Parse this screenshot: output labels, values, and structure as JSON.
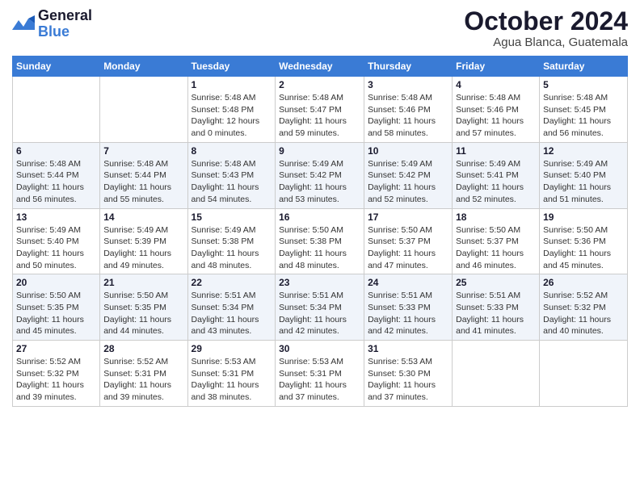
{
  "logo": {
    "text_general": "General",
    "text_blue": "Blue"
  },
  "header": {
    "month": "October 2024",
    "location": "Agua Blanca, Guatemala"
  },
  "weekdays": [
    "Sunday",
    "Monday",
    "Tuesday",
    "Wednesday",
    "Thursday",
    "Friday",
    "Saturday"
  ],
  "weeks": [
    [
      {
        "day": "",
        "info": ""
      },
      {
        "day": "",
        "info": ""
      },
      {
        "day": "1",
        "info": "Sunrise: 5:48 AM\nSunset: 5:48 PM\nDaylight: 12 hours\nand 0 minutes."
      },
      {
        "day": "2",
        "info": "Sunrise: 5:48 AM\nSunset: 5:47 PM\nDaylight: 11 hours\nand 59 minutes."
      },
      {
        "day": "3",
        "info": "Sunrise: 5:48 AM\nSunset: 5:46 PM\nDaylight: 11 hours\nand 58 minutes."
      },
      {
        "day": "4",
        "info": "Sunrise: 5:48 AM\nSunset: 5:46 PM\nDaylight: 11 hours\nand 57 minutes."
      },
      {
        "day": "5",
        "info": "Sunrise: 5:48 AM\nSunset: 5:45 PM\nDaylight: 11 hours\nand 56 minutes."
      }
    ],
    [
      {
        "day": "6",
        "info": "Sunrise: 5:48 AM\nSunset: 5:44 PM\nDaylight: 11 hours\nand 56 minutes."
      },
      {
        "day": "7",
        "info": "Sunrise: 5:48 AM\nSunset: 5:44 PM\nDaylight: 11 hours\nand 55 minutes."
      },
      {
        "day": "8",
        "info": "Sunrise: 5:48 AM\nSunset: 5:43 PM\nDaylight: 11 hours\nand 54 minutes."
      },
      {
        "day": "9",
        "info": "Sunrise: 5:49 AM\nSunset: 5:42 PM\nDaylight: 11 hours\nand 53 minutes."
      },
      {
        "day": "10",
        "info": "Sunrise: 5:49 AM\nSunset: 5:42 PM\nDaylight: 11 hours\nand 52 minutes."
      },
      {
        "day": "11",
        "info": "Sunrise: 5:49 AM\nSunset: 5:41 PM\nDaylight: 11 hours\nand 52 minutes."
      },
      {
        "day": "12",
        "info": "Sunrise: 5:49 AM\nSunset: 5:40 PM\nDaylight: 11 hours\nand 51 minutes."
      }
    ],
    [
      {
        "day": "13",
        "info": "Sunrise: 5:49 AM\nSunset: 5:40 PM\nDaylight: 11 hours\nand 50 minutes."
      },
      {
        "day": "14",
        "info": "Sunrise: 5:49 AM\nSunset: 5:39 PM\nDaylight: 11 hours\nand 49 minutes."
      },
      {
        "day": "15",
        "info": "Sunrise: 5:49 AM\nSunset: 5:38 PM\nDaylight: 11 hours\nand 48 minutes."
      },
      {
        "day": "16",
        "info": "Sunrise: 5:50 AM\nSunset: 5:38 PM\nDaylight: 11 hours\nand 48 minutes."
      },
      {
        "day": "17",
        "info": "Sunrise: 5:50 AM\nSunset: 5:37 PM\nDaylight: 11 hours\nand 47 minutes."
      },
      {
        "day": "18",
        "info": "Sunrise: 5:50 AM\nSunset: 5:37 PM\nDaylight: 11 hours\nand 46 minutes."
      },
      {
        "day": "19",
        "info": "Sunrise: 5:50 AM\nSunset: 5:36 PM\nDaylight: 11 hours\nand 45 minutes."
      }
    ],
    [
      {
        "day": "20",
        "info": "Sunrise: 5:50 AM\nSunset: 5:35 PM\nDaylight: 11 hours\nand 45 minutes."
      },
      {
        "day": "21",
        "info": "Sunrise: 5:50 AM\nSunset: 5:35 PM\nDaylight: 11 hours\nand 44 minutes."
      },
      {
        "day": "22",
        "info": "Sunrise: 5:51 AM\nSunset: 5:34 PM\nDaylight: 11 hours\nand 43 minutes."
      },
      {
        "day": "23",
        "info": "Sunrise: 5:51 AM\nSunset: 5:34 PM\nDaylight: 11 hours\nand 42 minutes."
      },
      {
        "day": "24",
        "info": "Sunrise: 5:51 AM\nSunset: 5:33 PM\nDaylight: 11 hours\nand 42 minutes."
      },
      {
        "day": "25",
        "info": "Sunrise: 5:51 AM\nSunset: 5:33 PM\nDaylight: 11 hours\nand 41 minutes."
      },
      {
        "day": "26",
        "info": "Sunrise: 5:52 AM\nSunset: 5:32 PM\nDaylight: 11 hours\nand 40 minutes."
      }
    ],
    [
      {
        "day": "27",
        "info": "Sunrise: 5:52 AM\nSunset: 5:32 PM\nDaylight: 11 hours\nand 39 minutes."
      },
      {
        "day": "28",
        "info": "Sunrise: 5:52 AM\nSunset: 5:31 PM\nDaylight: 11 hours\nand 39 minutes."
      },
      {
        "day": "29",
        "info": "Sunrise: 5:53 AM\nSunset: 5:31 PM\nDaylight: 11 hours\nand 38 minutes."
      },
      {
        "day": "30",
        "info": "Sunrise: 5:53 AM\nSunset: 5:31 PM\nDaylight: 11 hours\nand 37 minutes."
      },
      {
        "day": "31",
        "info": "Sunrise: 5:53 AM\nSunset: 5:30 PM\nDaylight: 11 hours\nand 37 minutes."
      },
      {
        "day": "",
        "info": ""
      },
      {
        "day": "",
        "info": ""
      }
    ]
  ]
}
